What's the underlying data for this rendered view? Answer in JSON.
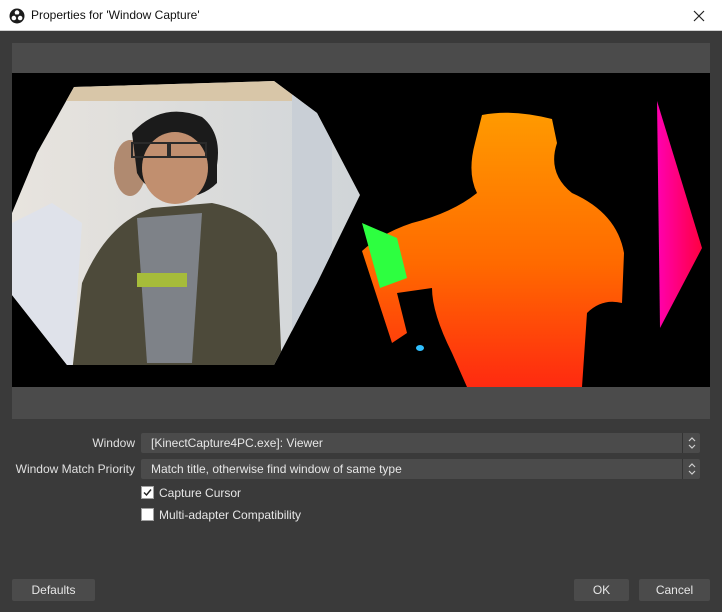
{
  "window": {
    "title": "Properties for 'Window Capture'",
    "icon": "obs-logo-icon",
    "close_icon": "close-icon"
  },
  "preview": {
    "description_icon": "kinect-color-and-depth-view"
  },
  "form": {
    "window_label": "Window",
    "window_value": "[KinectCapture4PC.exe]: Viewer",
    "match_priority_label": "Window Match Priority",
    "match_priority_value": "Match title, otherwise find window of same type",
    "capture_cursor_label": "Capture Cursor",
    "capture_cursor_checked": true,
    "multi_adapter_label": "Multi-adapter Compatibility",
    "multi_adapter_checked": false
  },
  "buttons": {
    "defaults": "Defaults",
    "ok": "OK",
    "cancel": "Cancel"
  },
  "colors": {
    "dialog_bg": "#3a3a3a",
    "control_bg": "#4b4b4b",
    "preview_bg": "#000000"
  }
}
